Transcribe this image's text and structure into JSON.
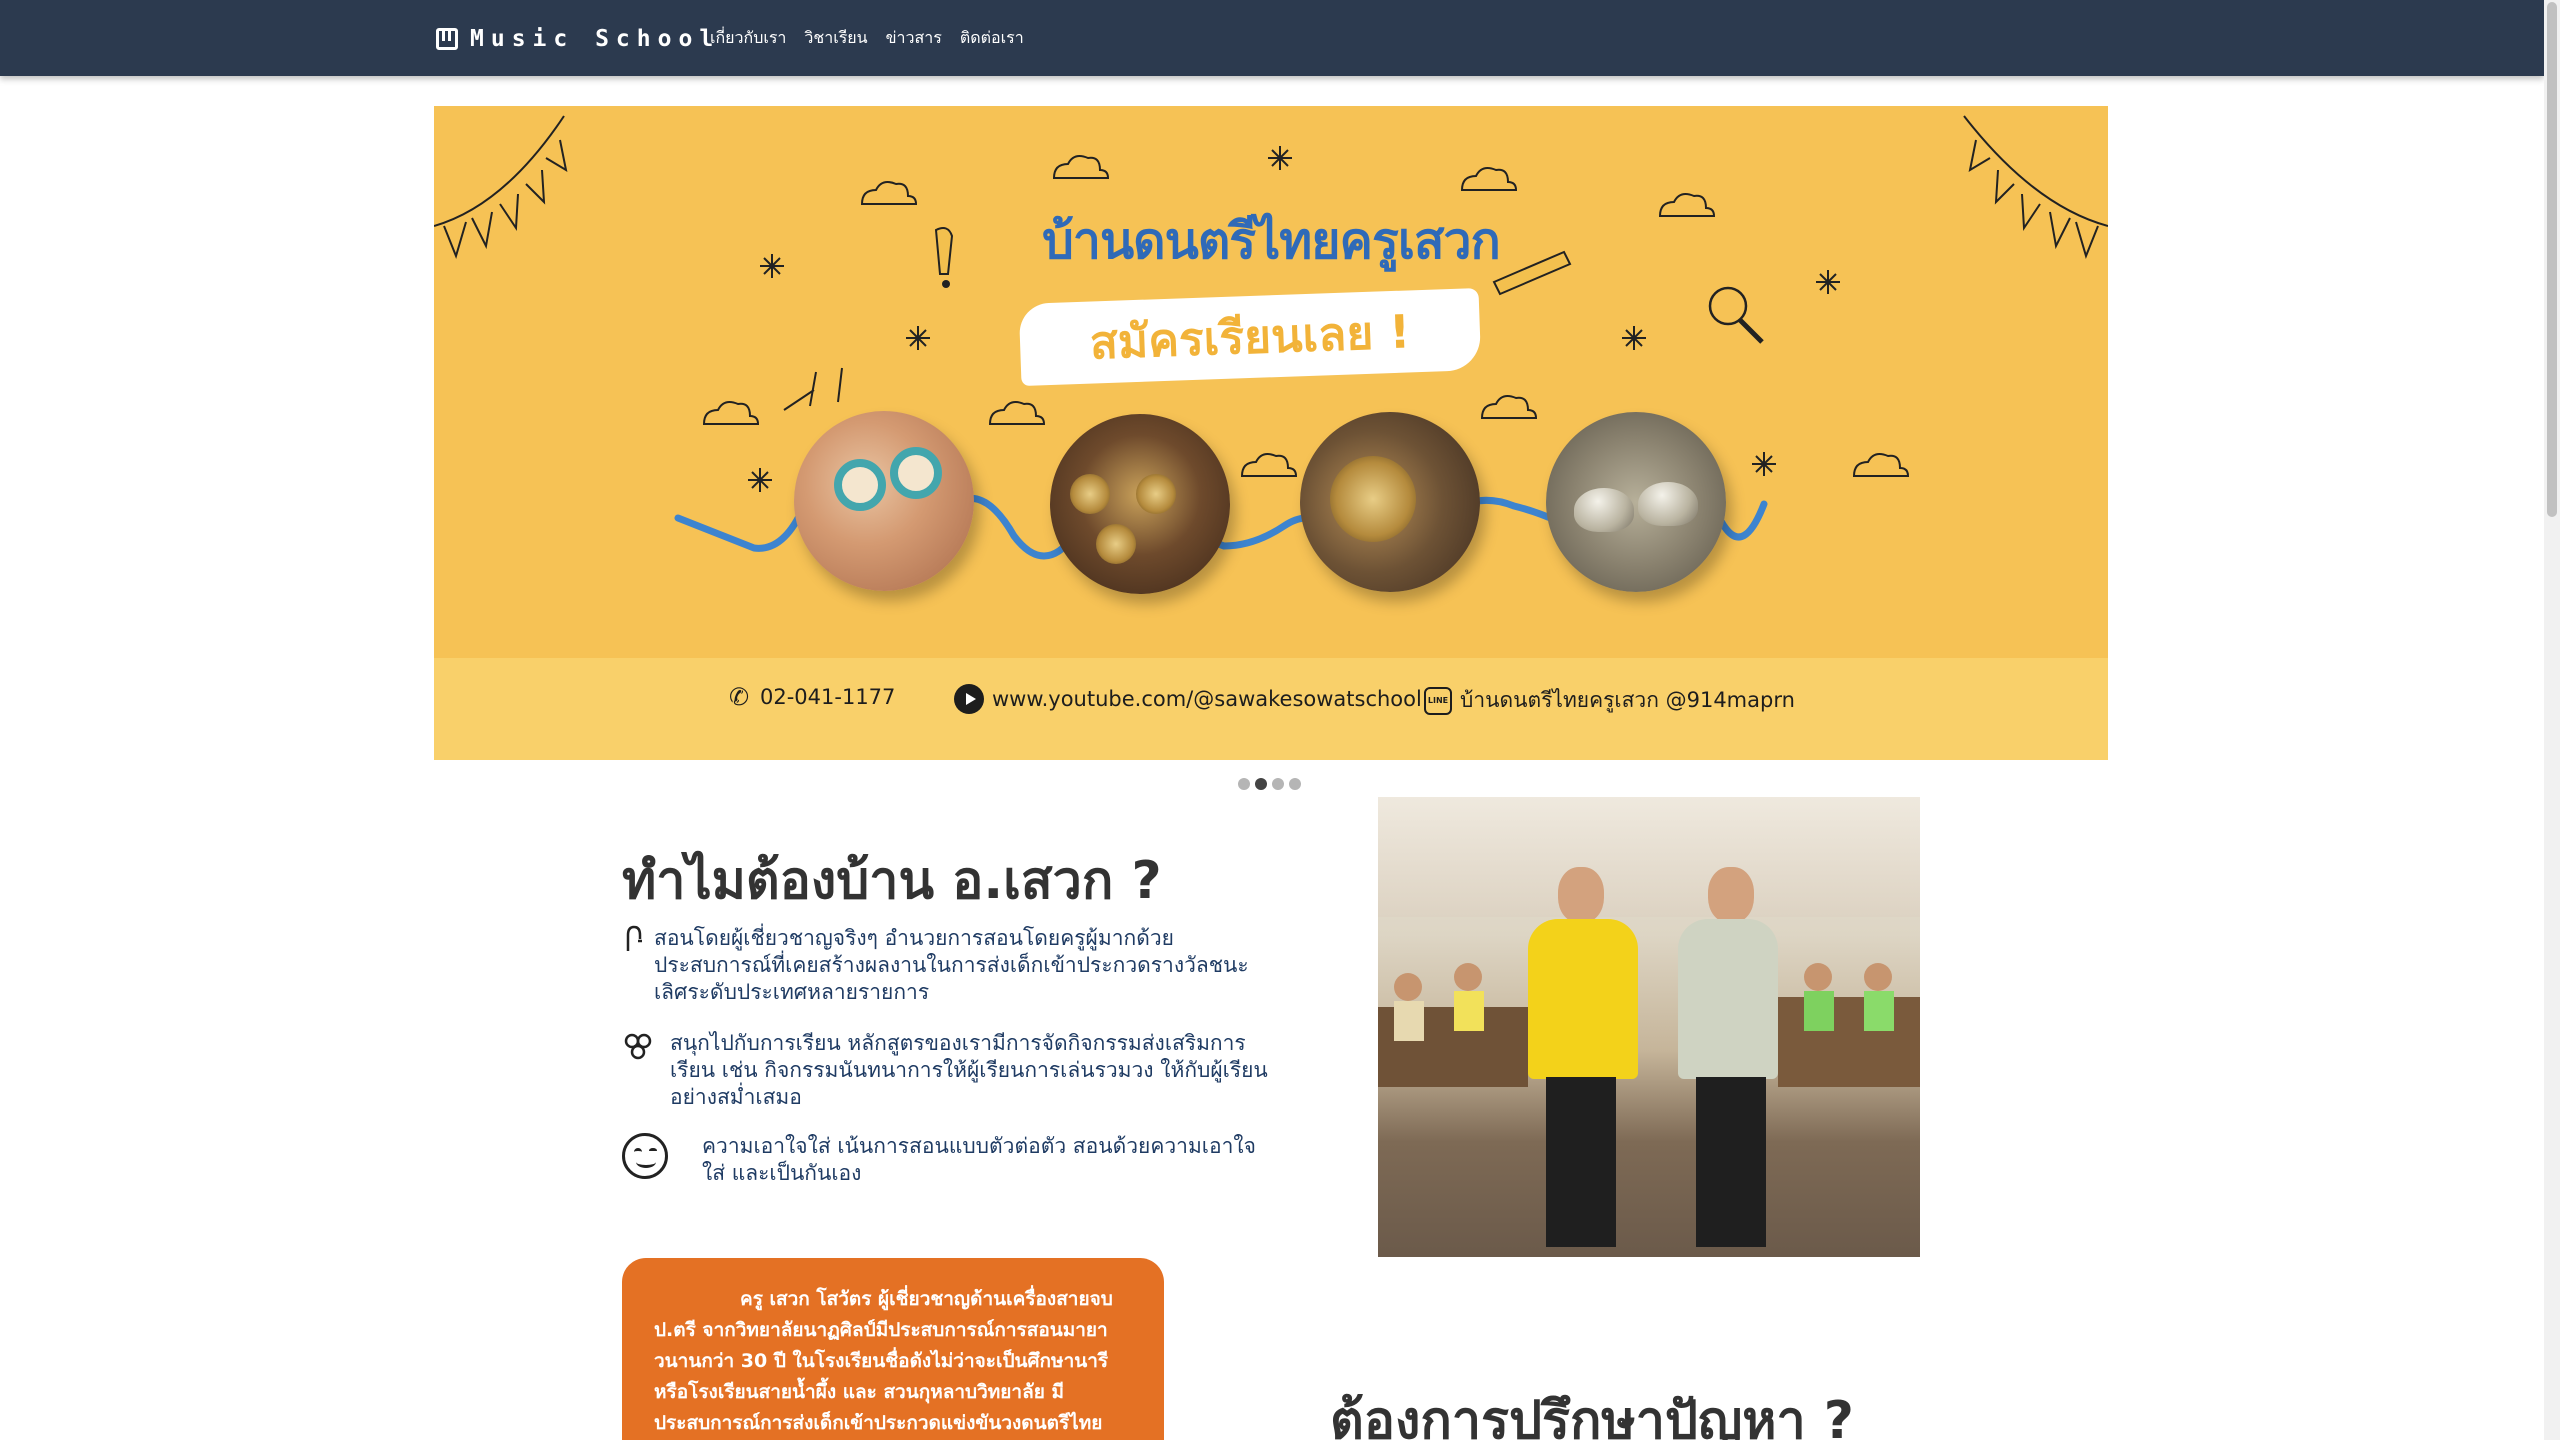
{
  "nav": {
    "brand": "Music School",
    "links": [
      "เกี่ยวกับเรา",
      "วิชาเรียน",
      "ข่าวสาร",
      "ติดต่อเรา"
    ]
  },
  "banner": {
    "title": "บ้านดนตรีไทยครูเสวก",
    "cta": "สมัครเรียนเลย !",
    "phone": "02-041-1177",
    "youtube": "www.youtube.com/@sawakesowatschool",
    "line": "บ้านดนตรีไทยครูเสวก @914maprn",
    "slide_count": 4,
    "active_slide": 2
  },
  "why": {
    "title": "ทำไมต้องบ้าน อ.เสวก ?",
    "features": [
      {
        "icon": "bow-icon",
        "text": "สอนโดยผู้เชี่ยวชาญจริงๆ อำนวยการสอนโดยครูผู้มากด้วยประสบการณ์ที่เคยสร้างผลงานในการส่งเด็กเข้าประกวดรางวัลชนะเลิศระดับประเทศหลายรายการ"
      },
      {
        "icon": "molecule-icon",
        "text": "สนุกไปกับการเรียน หลักสูตรของเรามีการจัดกิจกรรมส่งเสริมการเรียน เช่น กิจกรรมนันทนาการให้ผู้เรียนการเล่นรวมวง ให้กับผู้เรียนอย่างสม่ำเสมอ"
      },
      {
        "icon": "smile-icon",
        "text": "ความเอาใจใส่ เน้นการสอนแบบตัวต่อตัว สอนด้วยความเอาใจใส่ และเป็นกันเอง"
      }
    ]
  },
  "teacher": {
    "text": "ครู เสวก โสวัตร ผู้เชี่ยวชาญด้านเครื่องสายจบ ป.ตรี จากวิทยาลัยนาฏศิลป์มีประสบการณ์การสอนมายาวนานกว่า 30 ปี ในโรงเรียนชื่อดังไม่ว่าจะเป็นศึกษานารี หรือโรงเรียนสายน้ำผึ้ง และ สวนกุหลาบวิทยาลัย มีประสบการณ์การส่งเด็กเข้าประกวดแข่งขันวงดนตรีไทย"
  },
  "consult": {
    "title": "ต้องการปรึกษาปัญหา ?"
  },
  "colors": {
    "navbar": "#2c3a4f",
    "banner": "#f6c255",
    "banner_title": "#2f6ab8",
    "teacher_card": "#e47124"
  }
}
